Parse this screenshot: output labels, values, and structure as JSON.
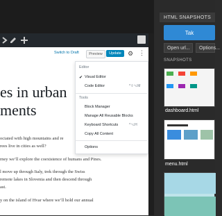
{
  "editor": {
    "toolbar_icons": [
      "chevron-right-icon",
      "plus-icon",
      "wp-logo-icon"
    ],
    "header": {
      "switch_to_draft": "Switch to Draft",
      "preview": "Preview",
      "update": "Update"
    },
    "document": {
      "title_line1": "es in urban",
      "title_line2": "ments",
      "para1_line1": "ociated with high mountains and re",
      "para1_line2": "rees live in cities as well?",
      "para2": "rney we’ll explore the coexistence of humans and Pines.",
      "para3_line1": "l move up through Italy, trek through the Swiss",
      "para3_line2": "remote lakes in Slovenia and then descend through",
      "para3_line3": "ast.",
      "para4": "y on the island of Hvar where we’ll hold our annual"
    },
    "menu": {
      "section_editor": "Editor",
      "visual_editor": "Visual Editor",
      "code_editor": "Code Editor",
      "code_editor_shortcut": "^⇧⌥M",
      "section_tools": "Tools",
      "block_manager": "Block Manager",
      "manage_reusable": "Manage All Reusable Blocks",
      "keyboard_shortcuts": "Keyboard Shortcuts",
      "keyboard_shortcut_key": "^⌥H",
      "copy_all": "Copy All Content",
      "options": "Options"
    }
  },
  "snapshots_panel": {
    "title": "HTML SNAPSHOTS",
    "take_button": "Tak",
    "open_url": "Open url...",
    "options": "Options...",
    "section_title": "SNAPSHOTS",
    "items": [
      {
        "name": "dashboard.html"
      },
      {
        "name": "menu.html"
      }
    ]
  }
}
